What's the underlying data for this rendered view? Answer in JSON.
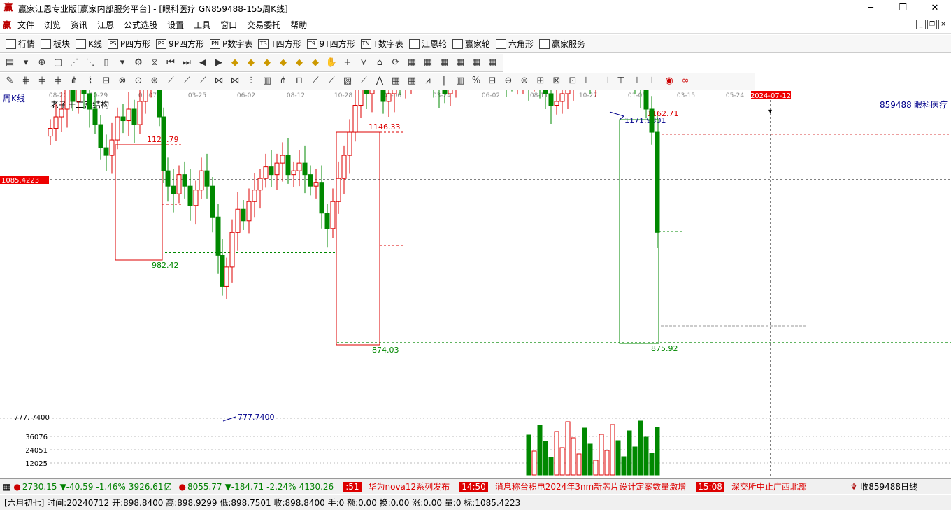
{
  "window": {
    "title": "赢家江恩专业版[赢家内部服务平台] - [眼科医疗   GN859488-155周K线]",
    "app_icon": "赢",
    "controls": [
      "─",
      "❐",
      "✕"
    ]
  },
  "menu": {
    "items": [
      "文件",
      "浏览",
      "资讯",
      "江恩",
      "公式选股",
      "设置",
      "工具",
      "窗口",
      "交易委托",
      "帮助"
    ]
  },
  "toolbar1": {
    "items": [
      {
        "icon": "grid-icon",
        "label": "行情"
      },
      {
        "icon": "block-icon",
        "label": "板块"
      },
      {
        "icon": "kline-icon",
        "label": "K线"
      },
      {
        "icon": "ps-icon",
        "label": "P四方形",
        "tag": "PS"
      },
      {
        "icon": "p9-icon",
        "label": "9P四方形",
        "tag": "P9"
      },
      {
        "icon": "pn-icon",
        "label": "P数字表",
        "tag": "PN"
      },
      {
        "icon": "ts-icon",
        "label": "T四方形",
        "tag": "TS"
      },
      {
        "icon": "t9-icon",
        "label": "9T四方形",
        "tag": "T9"
      },
      {
        "icon": "tn-icon",
        "label": "T数字表",
        "tag": "TN"
      },
      {
        "icon": "gann-wheel-icon",
        "label": "江恩轮"
      },
      {
        "icon": "winner-wheel-icon",
        "label": "赢家轮"
      },
      {
        "icon": "hexagon-icon",
        "label": "六角形"
      },
      {
        "icon": "dollar-icon",
        "label": "赢家服务"
      }
    ]
  },
  "chart_header": {
    "period": "周K线",
    "indicator": "老子十二宫结构",
    "code": "859488",
    "name": "眼科医疗"
  },
  "date_axis": [
    "08-20",
    "10-29",
    "01-07",
    "03-25",
    "06-02",
    "08-12",
    "10-28",
    "01-06",
    "03-24",
    "06-02",
    "08-11",
    "10-27",
    "01-05",
    "03-15",
    "05-24",
    "2024-07-12"
  ],
  "price_labels": {
    "cursor_price": "1085.4223",
    "high1": "1129.79",
    "low1": "982.42",
    "high2": "1146.33",
    "low2": "874.03",
    "high3": "1162.71",
    "high3b": "1171.9301",
    "low3": "875.92",
    "min": "777.7400",
    "axis_min": "777. 7400"
  },
  "volume_axis": [
    "36076",
    "24051",
    "12025"
  ],
  "statusbar": {
    "idx1_value": "2730.15",
    "idx1_change": "▼-40.59",
    "idx1_pct": "-1.46%",
    "idx1_amount": "3926.61亿",
    "idx2_value": "8055.77",
    "idx2_change": "▼-184.71",
    "idx2_pct": "-2.24%",
    "idx2_amount": "4130.26",
    "news": [
      {
        "time": ":51",
        "text": "华为nova12系列发布"
      },
      {
        "time": "14:50",
        "text": "消息称台积电2024年3nm新芯片设计定案数量激增"
      },
      {
        "time": "15:08",
        "text": "深交所中止广西北部"
      }
    ],
    "right_label": "收859488日线"
  },
  "bottom_info": "[六月初七] 时间:20240712 开:898.8400 高:898.9299 低:898.7501 收:898.8400 手:0 额:0.00 换:0.00 涨:0.00 量:0 标:1085.4223"
}
